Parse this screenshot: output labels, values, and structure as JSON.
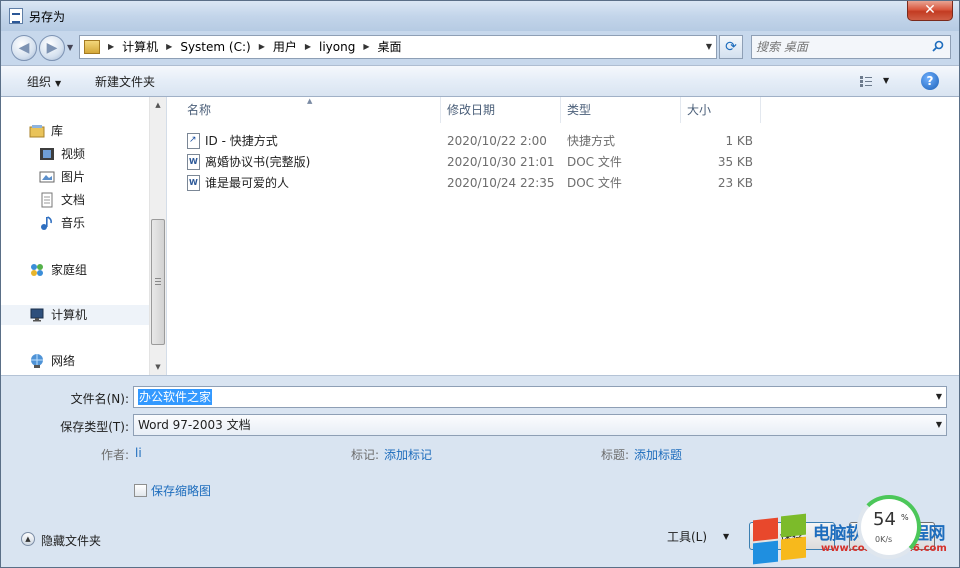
{
  "window": {
    "title": "另存为",
    "close_label": "✕"
  },
  "address": {
    "crumbs": [
      "计算机",
      "System (C:)",
      "用户",
      "liyong",
      "桌面"
    ],
    "search_placeholder": "搜索 桌面"
  },
  "toolbar": {
    "organize_label": "组织",
    "new_folder_label": "新建文件夹"
  },
  "nav": {
    "items": [
      {
        "label": "库",
        "icon": "library-icon"
      },
      {
        "label": "视频",
        "icon": "video-icon"
      },
      {
        "label": "图片",
        "icon": "picture-icon"
      },
      {
        "label": "文档",
        "icon": "document-icon"
      },
      {
        "label": "音乐",
        "icon": "music-icon"
      },
      {
        "label": "家庭组",
        "icon": "homegroup-icon"
      },
      {
        "label": "计算机",
        "icon": "computer-icon"
      },
      {
        "label": "网络",
        "icon": "network-icon"
      }
    ]
  },
  "columns": {
    "name": "名称",
    "modified": "修改日期",
    "type": "类型",
    "size": "大小"
  },
  "files": [
    {
      "name": "ID - 快捷方式",
      "modified": "2020/10/22 2:00",
      "type": "快捷方式",
      "size": "1 KB",
      "icon": "shortcut-icon"
    },
    {
      "name": "离婚协议书(完整版)",
      "modified": "2020/10/30 21:01",
      "type": "DOC 文件",
      "size": "35 KB",
      "icon": "doc-file-icon"
    },
    {
      "name": "谁是最可爱的人",
      "modified": "2020/10/24 22:35",
      "type": "DOC 文件",
      "size": "23 KB",
      "icon": "doc-file-icon"
    }
  ],
  "form": {
    "filename_label": "文件名(N):",
    "filename_value": "办公软件之家",
    "filetype_label": "保存类型(T):",
    "filetype_value": "Word 97-2003 文档",
    "author_label": "作者:",
    "author_value": "li",
    "tags_label": "标记:",
    "tags_value": "添加标记",
    "title_label": "标题:",
    "title_value": "添加标题",
    "thumbnail_label": "保存缩略图",
    "thumbnail_checked": false
  },
  "footer": {
    "hide_folders_label": "隐藏文件夹",
    "tools_label": "工具(L)",
    "save_label": "保存"
  },
  "overlay": {
    "watermark_text": "电脑软硬件教程网",
    "watermark_url": "www.computer26.com",
    "gauge_percent": "54",
    "gauge_percent_sign": "%",
    "gauge_speed": "0K/s",
    "gauge_value": 0.54
  },
  "colors": {
    "link": "#1e6dbd",
    "selection": "#3399ff",
    "gauge_green": "#4cc75a"
  }
}
